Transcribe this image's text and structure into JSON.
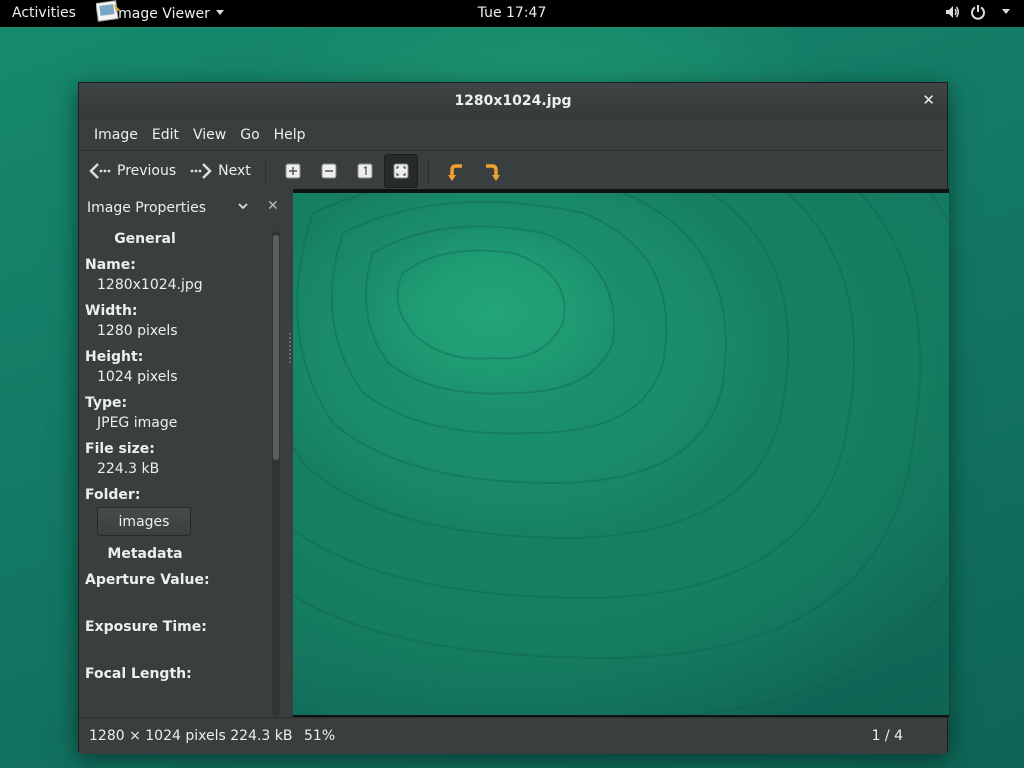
{
  "topbar": {
    "activities": "Activities",
    "app_menu": "Image Viewer",
    "clock": "Tue 17:47",
    "icons": [
      "volume-icon",
      "power-icon",
      "chevron-down-icon"
    ]
  },
  "window": {
    "title": "1280x1024.jpg",
    "menu": [
      "Image",
      "Edit",
      "View",
      "Go",
      "Help"
    ],
    "toolbar": {
      "previous": "Previous",
      "next": "Next",
      "icons": [
        "zoom-in-icon",
        "zoom-out-icon",
        "original-size-icon",
        "best-fit-icon",
        "rotate-left-icon",
        "rotate-right-icon"
      ]
    },
    "sidebar": {
      "title": "Image Properties",
      "general": "General",
      "name_label": "Name:",
      "name_value": "1280x1024.jpg",
      "width_label": "Width:",
      "width_value": "1280 pixels",
      "height_label": "Height:",
      "height_value": "1024 pixels",
      "type_label": "Type:",
      "type_value": "JPEG image",
      "size_label": "File size:",
      "size_value": "224.3 kB",
      "folder_label": "Folder:",
      "folder_button": "images",
      "metadata": "Metadata",
      "aperture_label": "Aperture Value:",
      "exposure_label": "Exposure Time:",
      "focal_label": "Focal Length:"
    },
    "statusbar": {
      "info": "1280 × 1024 pixels  224.3 kB",
      "zoom": "51%",
      "count": "1 / 4"
    }
  },
  "colors": {
    "window_bg": "#393f3f",
    "accent_arrow": "#f0a030",
    "desktop": "#16826b"
  }
}
